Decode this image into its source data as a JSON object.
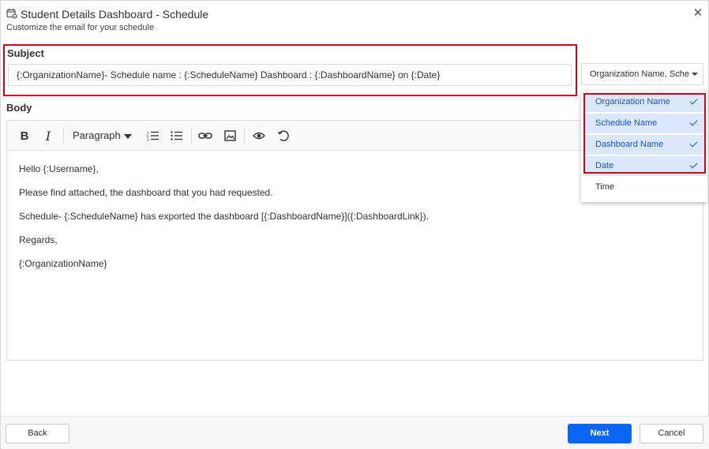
{
  "header": {
    "title": "Student Details Dashboard - Schedule",
    "subtitle": "Customize the email for your schedule",
    "icon": "calendar-settings-icon",
    "close_icon": "close-icon"
  },
  "subject": {
    "label": "Subject",
    "value": "{:OrganizationName}- Schedule name : {:ScheduleName} Dashboard : {:DashboardName} on {:Date}",
    "field_dropdown_value": "Organization Name, Sche"
  },
  "field_options": [
    {
      "label": "Organization Name",
      "selected": true
    },
    {
      "label": "Schedule Name",
      "selected": true
    },
    {
      "label": "Dashboard Name",
      "selected": true
    },
    {
      "label": "Date",
      "selected": true
    },
    {
      "label": "Time",
      "selected": false
    }
  ],
  "body": {
    "label": "Body",
    "toolbar": {
      "bold_icon": "B",
      "italic_icon": "I",
      "paragraph_label": "Paragraph",
      "icons": [
        "bold-icon",
        "italic-icon",
        "ordered-list-icon",
        "unordered-list-icon",
        "link-icon",
        "image-icon",
        "preview-eye-icon",
        "reset-icon"
      ]
    },
    "lines": [
      "Hello {:Username},",
      "Please find attached, the dashboard that you had requested.",
      "Schedule- {:ScheduleName} has exported the dashboard [{:DashboardName}]({:DashboardLink}).",
      "Regards,",
      "{:OrganizationName}"
    ]
  },
  "footer": {
    "back_label": "Back",
    "next_label": "Next",
    "cancel_label": "Cancel"
  },
  "colors": {
    "accent": "#0b65f5",
    "highlight_border": "#d0021b",
    "selected_option_bg": "#dbe7fb",
    "selected_option_text": "#1a56d6"
  }
}
